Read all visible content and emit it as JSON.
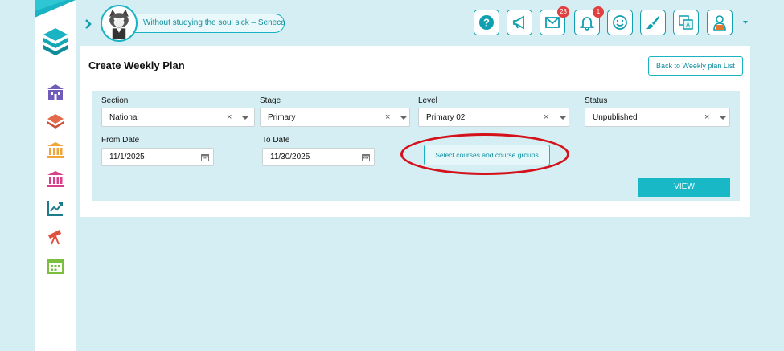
{
  "header": {
    "quote": "Without studying the soul sick – Seneca",
    "messages_badge": "28",
    "notifications_badge": "1"
  },
  "sidebar": {
    "items": [
      {
        "icon": "school-building-icon",
        "color": "#6f5bb8"
      },
      {
        "icon": "layers-icon",
        "color": "#e46a4a"
      },
      {
        "icon": "institution-icon",
        "color": "#f0a53a"
      },
      {
        "icon": "institution-icon",
        "color": "#d8408a"
      },
      {
        "icon": "chart-line-icon",
        "color": "#1b7d8c"
      },
      {
        "icon": "telescope-icon",
        "color": "#e0503c"
      },
      {
        "icon": "calendar-icon",
        "color": "#7bbf3e"
      }
    ]
  },
  "page": {
    "title": "Create Weekly Plan",
    "back_label": "Back to Weekly plan List"
  },
  "filters": {
    "section": {
      "label": "Section",
      "value": "National"
    },
    "stage": {
      "label": "Stage",
      "value": "Primary"
    },
    "level": {
      "label": "Level",
      "value": "Primary 02"
    },
    "status": {
      "label": "Status",
      "value": "Unpublished"
    },
    "from_date": {
      "label": "From Date",
      "value": "11/1/2025"
    },
    "to_date": {
      "label": "To Date",
      "value": "11/30/2025"
    },
    "courses_button": "Select courses and course groups",
    "view_button": "VIEW"
  },
  "colors": {
    "accent": "#19b3c3",
    "background": "#d4eef3",
    "badge": "#e0403f",
    "highlight": "#d3121b"
  }
}
